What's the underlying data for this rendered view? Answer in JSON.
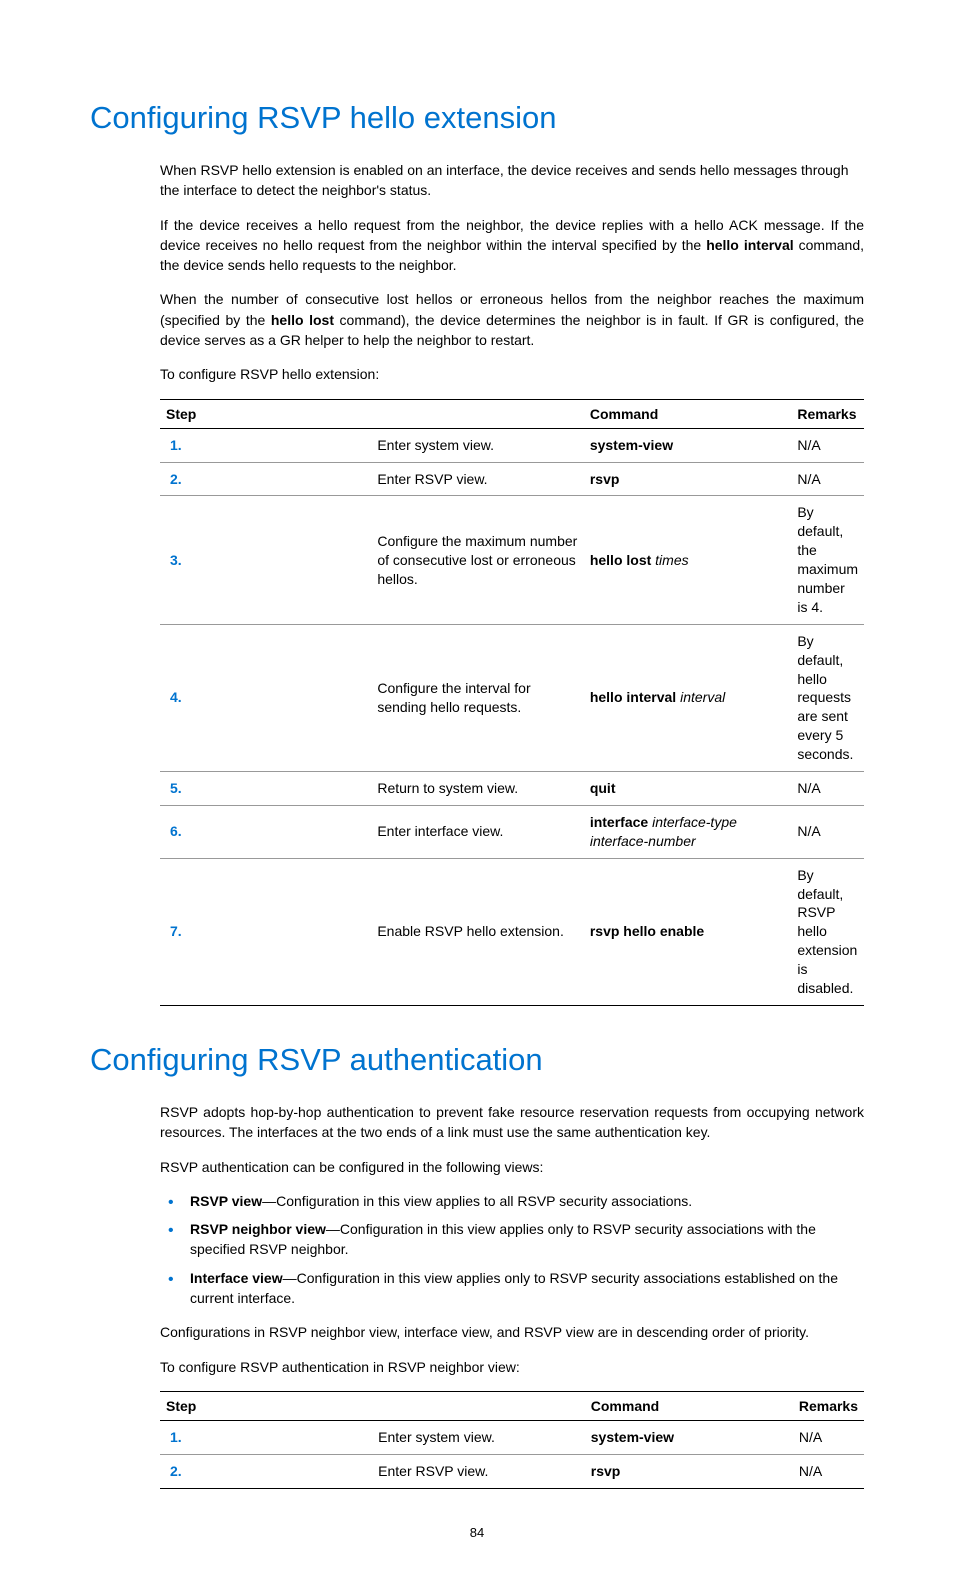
{
  "page_number": "84",
  "section1": {
    "title": "Configuring RSVP hello extension",
    "p1": "When RSVP hello extension is enabled on an interface, the device receives and sends hello messages through the interface to detect the neighbor's status.",
    "p2a": "If the device receives a hello request from the neighbor, the device replies with a hello ACK message. If the device receives no hello request from the neighbor within the interval specified by the ",
    "p2b": "hello interval",
    "p2c": " command, the device sends hello requests to the neighbor.",
    "p3a": "When the number of consecutive lost hellos or erroneous hellos from the neighbor reaches the maximum (specified by the ",
    "p3b": "hello lost",
    "p3c": " command), the device determines the neighbor is in fault. If GR is configured, the device serves as a GR helper to help the neighbor to restart.",
    "p4": "To configure RSVP hello extension:",
    "th_step": "Step",
    "th_cmd": "Command",
    "th_rem": "Remarks",
    "r1": {
      "n": "1.",
      "step": "Enter system view.",
      "cmd": "system-view",
      "rem": "N/A"
    },
    "r2": {
      "n": "2.",
      "step": "Enter RSVP view.",
      "cmd": "rsvp",
      "rem": "N/A"
    },
    "r3": {
      "n": "3.",
      "step": "Configure the maximum number of consecutive lost or erroneous hellos.",
      "cmd_b": "hello lost ",
      "cmd_i": "times",
      "rem": "By default, the maximum number is 4."
    },
    "r4": {
      "n": "4.",
      "step": "Configure the interval for sending hello requests.",
      "cmd_b": "hello interval ",
      "cmd_i": "interval",
      "rem": "By default, hello requests are sent every 5 seconds."
    },
    "r5": {
      "n": "5.",
      "step": "Return to system view.",
      "cmd": "quit",
      "rem": "N/A"
    },
    "r6": {
      "n": "6.",
      "step": "Enter interface view.",
      "cmd_b": "interface ",
      "cmd_i": "interface-type interface-number",
      "rem": "N/A"
    },
    "r7": {
      "n": "7.",
      "step": "Enable RSVP hello extension.",
      "cmd": "rsvp hello enable",
      "rem": "By default, RSVP hello extension is disabled."
    }
  },
  "section2": {
    "title": "Configuring RSVP authentication",
    "p1": "RSVP adopts hop-by-hop authentication to prevent fake resource reservation requests from occupying network resources. The interfaces at the two ends of a link must use the same authentication key.",
    "p2": "RSVP authentication can be configured in the following views:",
    "b1a": "RSVP view",
    "b1b": "—Configuration in this view applies to all RSVP security associations.",
    "b2a": "RSVP neighbor view",
    "b2b": "—Configuration in this view applies only to RSVP security associations with the specified RSVP neighbor.",
    "b3a": "Interface view",
    "b3b": "—Configuration in this view applies only to RSVP security associations established on the current interface.",
    "p3": "Configurations in RSVP neighbor view, interface view, and RSVP view are in descending order of priority.",
    "p4": "To configure RSVP authentication in RSVP neighbor view:",
    "th_step": "Step",
    "th_cmd": "Command",
    "th_rem": "Remarks",
    "r1": {
      "n": "1.",
      "step": "Enter system view.",
      "cmd": "system-view",
      "rem": "N/A"
    },
    "r2": {
      "n": "2.",
      "step": "Enter RSVP view.",
      "cmd": "rsvp",
      "rem": "N/A"
    }
  }
}
